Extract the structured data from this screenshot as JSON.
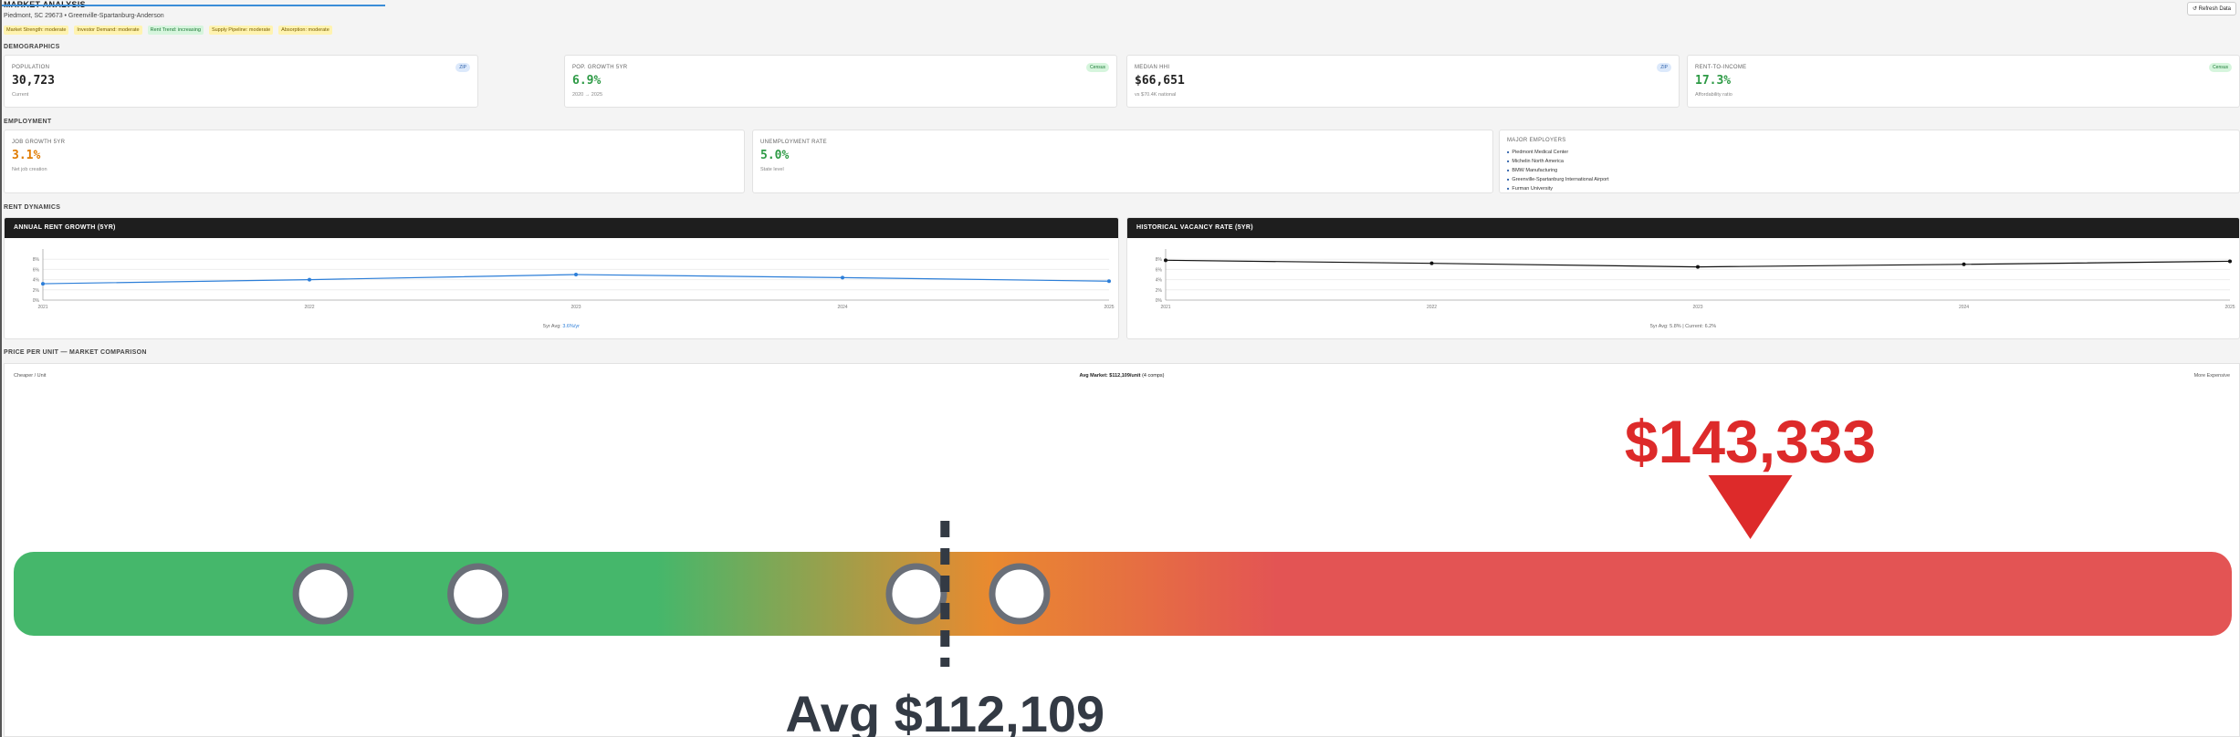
{
  "header": {
    "title": "MARKET ANALYSIS",
    "subtitle": "Piedmont, SC 29673 • Greenville-Spartanburg-Anderson",
    "refresh_label": "↺ Refresh Data",
    "tags": [
      {
        "label": "Market Strength: moderate",
        "color": "#fff3b0"
      },
      {
        "label": "Investor Demand: moderate",
        "color": "#fff3b0"
      },
      {
        "label": "Rent Trend: increasing",
        "color": "#d6f5dd"
      },
      {
        "label": "Supply Pipeline: moderate",
        "color": "#fff3b0"
      },
      {
        "label": "Absorption: moderate",
        "color": "#fff3b0"
      }
    ]
  },
  "demographics": {
    "section_label": "DEMOGRAPHICS",
    "cards": [
      {
        "label": "POPULATION",
        "value": "30,723",
        "sub": "Current",
        "badge": "ZIP"
      },
      {
        "label": "POP. GROWTH 5YR",
        "value": "6.9%",
        "sub": "2020 → 2025",
        "badge": "Census"
      },
      {
        "label": "MEDIAN HHI",
        "value": "$66,651",
        "sub": "vs $70.4K national",
        "badge": "ZIP"
      },
      {
        "label": "RENT-TO-INCOME",
        "value": "17.3%",
        "sub": "Affordability ratio",
        "badge": "Census"
      }
    ]
  },
  "employment": {
    "section_label": "EMPLOYMENT",
    "job_growth": {
      "label": "JOB GROWTH 5YR",
      "value": "3.1%",
      "sub": "Net job creation"
    },
    "unemployment": {
      "label": "UNEMPLOYMENT RATE",
      "value": "5.0%",
      "sub": "State level"
    },
    "employers": {
      "label": "MAJOR EMPLOYERS",
      "items": [
        "Piedmont Medical Center",
        "Michelin North America",
        "BMW Manufacturing",
        "Greenville-Spartanburg International Airport",
        "Furman University"
      ]
    }
  },
  "rent_dynamics": {
    "section_label": "RENT DYNAMICS",
    "rent_chart": {
      "title": "ANNUAL RENT GROWTH (5YR)",
      "foot_prefix": "5yr Avg: ",
      "foot_value": "3.6%/yr"
    },
    "vacancy_chart": {
      "title": "HISTORICAL VACANCY RATE (5YR)",
      "foot": "5yr Avg: 5.8% | Current: 6.2%"
    }
  },
  "chart_data": [
    {
      "type": "line",
      "title": "ANNUAL RENT GROWTH (5YR)",
      "x": [
        "2021",
        "2022",
        "2023",
        "2024",
        "2025"
      ],
      "series": [
        {
          "values": [
            3.2,
            4.0,
            5.0,
            4.4,
            3.7
          ]
        }
      ],
      "ylim": [
        0,
        10
      ],
      "yticks": [
        "0%",
        "2%",
        "4%",
        "6%",
        "8%"
      ],
      "color": "#2c7ed8"
    },
    {
      "type": "line",
      "title": "HISTORICAL VACANCY RATE (5YR)",
      "x": [
        "2021",
        "2022",
        "2023",
        "2024",
        "2025"
      ],
      "series": [
        {
          "values": [
            7.8,
            7.2,
            6.5,
            7.0,
            7.6
          ]
        }
      ],
      "ylim": [
        0,
        10
      ],
      "yticks": [
        "0%",
        "2%",
        "4%",
        "6%",
        "8%"
      ],
      "color": "#111111"
    }
  ],
  "comparison": {
    "section_label": "PRICE PER UNIT — MARKET COMPARISON",
    "left_label": "Cheaper / Unit",
    "avg_market": "Avg Market: $112,109/unit",
    "comps_count": "(4 comps)",
    "right_label": "More Expensive",
    "subject_value": "$143,333",
    "avg_label": "Avg $112,109",
    "scale_min": 76000,
    "scale_max": 162000,
    "avg_value": 112109,
    "subject_numeric": 143333,
    "comp_values": [
      88000,
      94000,
      111000,
      115000
    ],
    "colors": {
      "green": "#45b76b",
      "orange": "#e98a2f",
      "red": "#e35454",
      "marker": "#dd2a2a",
      "dark": "#333a44"
    }
  }
}
